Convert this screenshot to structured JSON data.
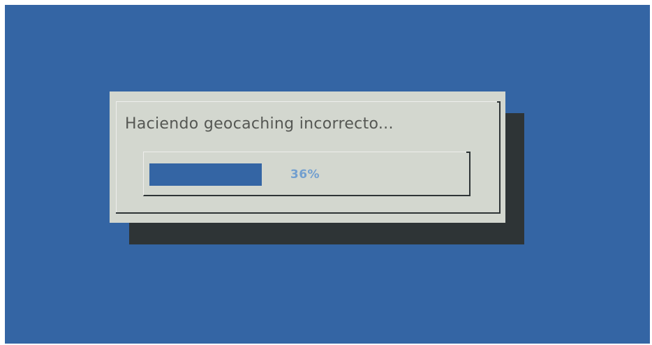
{
  "dialog": {
    "title": "Haciendo geocaching incorrecto...",
    "progress": {
      "value": 0.36,
      "label": "36%"
    }
  },
  "colors": {
    "desktop": "#3465a4",
    "dialog": "#d3d7cf",
    "shadow": "#2e3436",
    "gauge_fill": "#3465a4",
    "gauge_text": "#729fcf",
    "title_text": "#555753"
  }
}
